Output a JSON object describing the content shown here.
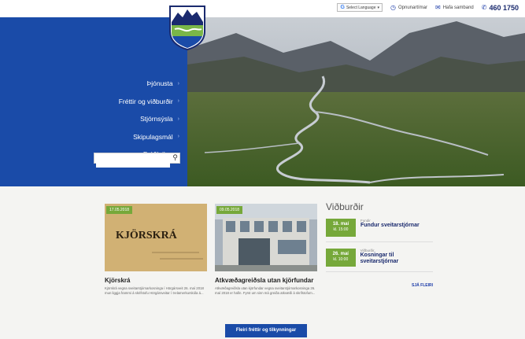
{
  "topbar": {
    "language_label": "Select Language",
    "opening_hours": "Opnunartímar",
    "contact": "Hafa samband",
    "phone": "460 1750"
  },
  "nav": {
    "items": [
      {
        "label": "Þjónusta"
      },
      {
        "label": "Fréttir og viðburðir"
      },
      {
        "label": "Stjórnsýsla"
      },
      {
        "label": "Skipulagsmál"
      },
      {
        "label": "Fróðleikur"
      }
    ]
  },
  "search": {
    "placeholder": ""
  },
  "news": [
    {
      "date": "17.05.2018",
      "image_text": "KJÖRSKRÁ",
      "title": "Kjörskrá",
      "excerpt": "Kjörskrá vegna sveitarstjórnarkosninga í Hörgársveit 26. maí 2018 mun liggja frammi á skrifstofu Hörgársveitar í Þelamerkurskóla á..."
    },
    {
      "date": "09.05.2018",
      "title": "Atkvæðagreiðsla utan kjörfundar",
      "excerpt": "Atkvæðagreiðsla utan kjörfundar vegna sveitarstjórnarkosninga 26. maí 2018 er hafin. Fyrst um sinn má greiða atkvæði á skrifstofum..."
    }
  ],
  "events": {
    "title": "Viðburðir",
    "items": [
      {
        "day": "18. maí",
        "time": "kl. 15:00",
        "category": "Fundir",
        "name": "Fundur sveitarstjórnar"
      },
      {
        "day": "26. maí",
        "time": "kl. 10:00",
        "category": "Viðburðir",
        "name": "Kosningar til sveitarstjórnar"
      }
    ],
    "see_more": "SJÁ FLEIRI"
  },
  "more_button": "Fleiri fréttir og tilkynningar",
  "colors": {
    "brand_blue": "#1a4ba8",
    "accent_green": "#76a83a"
  }
}
